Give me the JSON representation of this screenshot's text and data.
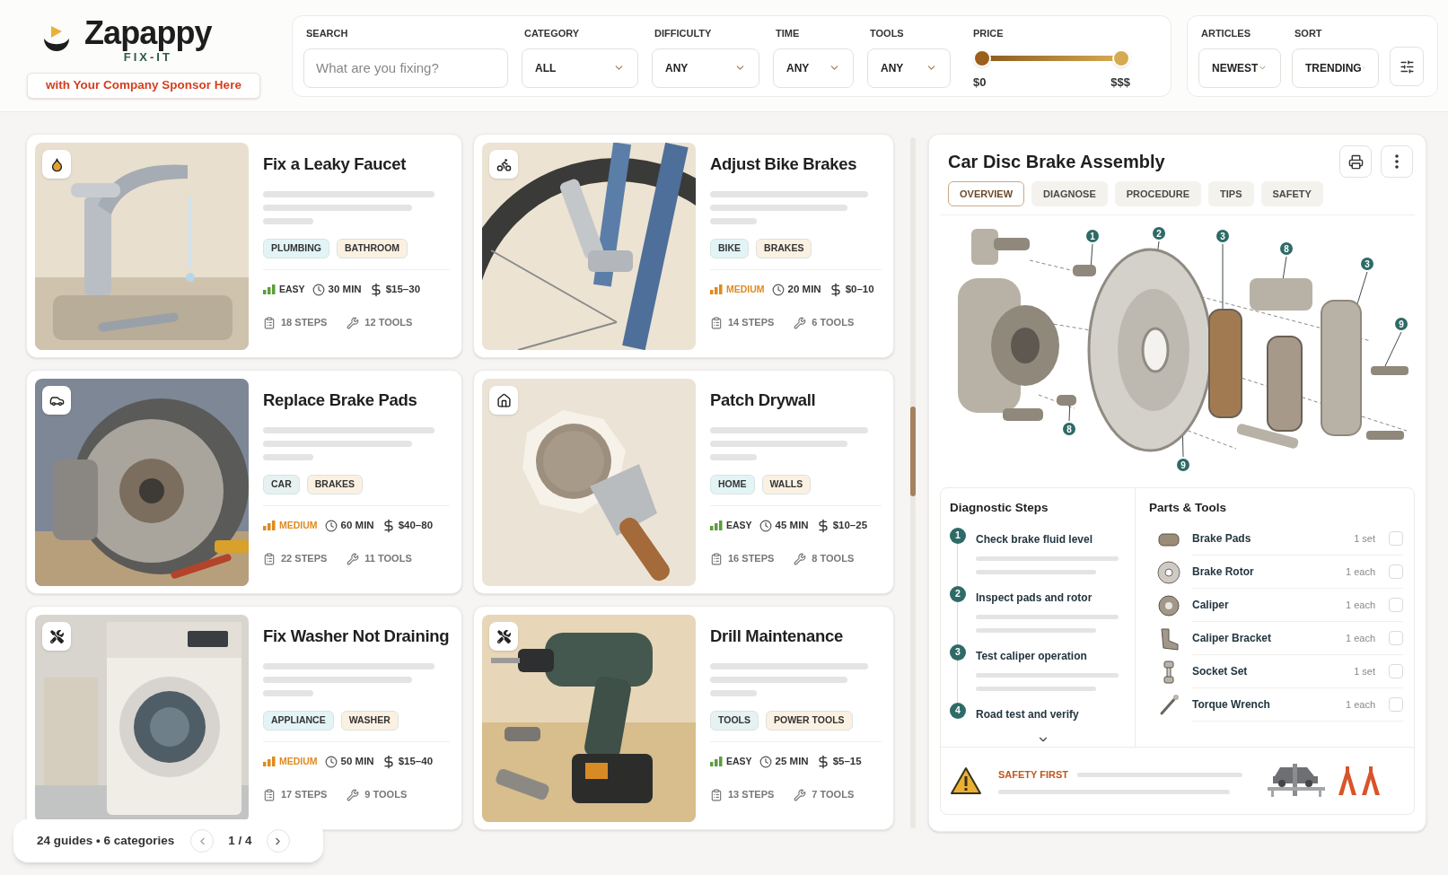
{
  "brand": {
    "name": "Zapappy",
    "tagline": "FIX-IT",
    "sponsor": "with Your Company Sponsor Here"
  },
  "filters": {
    "search": {
      "label": "SEARCH",
      "placeholder": "What are you fixing?"
    },
    "selects": [
      {
        "label": "CATEGORY",
        "value": "ALL"
      },
      {
        "label": "DIFFICULTY",
        "value": "ANY"
      },
      {
        "label": "TIME",
        "value": "ANY"
      },
      {
        "label": "TOOLS",
        "value": "ANY"
      }
    ],
    "price": {
      "label": "PRICE",
      "min_label": "$0",
      "max_label": "$$$",
      "thumbs": [
        {
          "level": 0
        },
        {
          "level": 1
        }
      ]
    }
  },
  "sorting": [
    {
      "label": "ARTICLES",
      "value": "NEWEST"
    },
    {
      "label": "SORT",
      "value": "TRENDING"
    }
  ],
  "guides": [
    {
      "kind": "plumbing",
      "title": "Fix a Leaky Faucet",
      "tags": [
        {
          "label": "PLUMBING",
          "color": "#e3f4f7"
        },
        {
          "label": "BATHROOM",
          "color": "#fbf1e2"
        }
      ],
      "difficulty": {
        "kind": "easy",
        "label": "EASY"
      },
      "time": "30 MIN",
      "price": "$15–30",
      "steps": "18 STEPS",
      "tools": "12 TOOLS"
    },
    {
      "kind": "bike",
      "title": "Adjust Bike Brakes",
      "tags": [
        {
          "label": "BIKE",
          "color": "#e3f4f7"
        },
        {
          "label": "BRAKES",
          "color": "#fbf1e2"
        }
      ],
      "difficulty": {
        "kind": "medium",
        "label": "MEDIUM"
      },
      "time": "20 MIN",
      "price": "$0–10",
      "steps": "14 STEPS",
      "tools": "6 TOOLS"
    },
    {
      "kind": "car",
      "title": "Replace Brake Pads",
      "tags": [
        {
          "label": "CAR",
          "color": "#e6f2f1"
        },
        {
          "label": "BRAKES",
          "color": "#fbf1e2"
        }
      ],
      "difficulty": {
        "kind": "medium",
        "label": "MEDIUM"
      },
      "time": "60 MIN",
      "price": "$40–80",
      "steps": "22 STEPS",
      "tools": "11 TOOLS"
    },
    {
      "kind": "home",
      "title": "Patch Drywall",
      "tags": [
        {
          "label": "HOME",
          "color": "#e3f4f7"
        },
        {
          "label": "WALLS",
          "color": "#fbf1e2"
        }
      ],
      "difficulty": {
        "kind": "easy",
        "label": "EASY"
      },
      "time": "45 MIN",
      "price": "$10–25",
      "steps": "16 STEPS",
      "tools": "8 TOOLS"
    },
    {
      "kind": "appliance",
      "title": "Fix Washer Not Draining",
      "tags": [
        {
          "label": "APPLIANCE",
          "color": "#e3f4f7"
        },
        {
          "label": "WASHER",
          "color": "#fbf1e2"
        }
      ],
      "difficulty": {
        "kind": "medium",
        "label": "MEDIUM"
      },
      "time": "50 MIN",
      "price": "$15–40",
      "steps": "17 STEPS",
      "tools": "9 TOOLS"
    },
    {
      "kind": "tools",
      "title": "Drill Maintenance",
      "tags": [
        {
          "label": "TOOLS",
          "color": "#e6f2f1"
        },
        {
          "label": "POWER TOOLS",
          "color": "#fbf1e2"
        }
      ],
      "difficulty": {
        "kind": "easy",
        "label": "EASY"
      },
      "time": "25 MIN",
      "price": "$5–15",
      "steps": "13 STEPS",
      "tools": "7 TOOLS"
    }
  ],
  "footer": {
    "summary": "24 guides • 6 categories",
    "page": "1 / 4"
  },
  "detail": {
    "title": "Car Disc Brake Assembly",
    "tabs": [
      {
        "label": "OVERVIEW",
        "selected": true
      },
      {
        "label": "DIAGNOSE",
        "selected": false
      },
      {
        "label": "PROCEDURE",
        "selected": false
      },
      {
        "label": "TIPS",
        "selected": false
      },
      {
        "label": "SAFETY",
        "selected": false
      }
    ],
    "callouts": [
      "1",
      "2",
      "3",
      "8",
      "3",
      "9",
      "8",
      "9"
    ],
    "diagnostic": {
      "title": "Diagnostic Steps",
      "steps": [
        {
          "number": "1",
          "text": "Check brake fluid level"
        },
        {
          "number": "2",
          "text": "Inspect pads and rotor"
        },
        {
          "number": "3",
          "text": "Test caliper operation"
        },
        {
          "number": "4",
          "text": "Road test and verify"
        }
      ]
    },
    "parts": {
      "title": "Parts & Tools",
      "items": [
        {
          "kind": "pad",
          "name": "Brake Pads",
          "quantity": "1 set",
          "checked": false
        },
        {
          "kind": "rotor",
          "name": "Brake Rotor",
          "quantity": "1 each",
          "checked": false
        },
        {
          "kind": "caliper",
          "name": "Caliper",
          "quantity": "1 each",
          "checked": false
        },
        {
          "kind": "bracket",
          "name": "Caliper Bracket",
          "quantity": "1 each",
          "checked": false
        },
        {
          "kind": "socket",
          "name": "Socket Set",
          "quantity": "1 set",
          "checked": false
        },
        {
          "kind": "wrench",
          "name": "Torque Wrench",
          "quantity": "1 each",
          "checked": false
        }
      ]
    },
    "safety": {
      "title": "SAFETY FIRST"
    }
  }
}
